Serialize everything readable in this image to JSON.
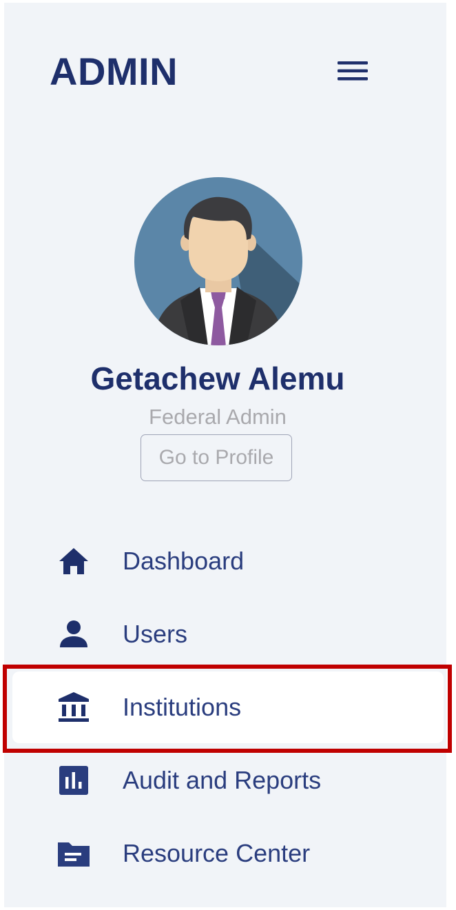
{
  "brand": {
    "title": "ADMIN"
  },
  "header": {
    "menu_icon": "hamburger-menu-icon"
  },
  "profile": {
    "name": "Getachew Alemu",
    "role": "Federal Admin",
    "button_label": "Go to Profile",
    "avatar_icon": "user-avatar"
  },
  "nav": {
    "items": [
      {
        "label": "Dashboard",
        "icon": "home-icon",
        "active": false
      },
      {
        "label": "Users",
        "icon": "user-icon",
        "active": false
      },
      {
        "label": "Institutions",
        "icon": "institution-icon",
        "active": true
      },
      {
        "label": "Audit and Reports",
        "icon": "bar-chart-icon",
        "active": false
      },
      {
        "label": "Resource Center",
        "icon": "folder-icon",
        "active": false
      }
    ]
  },
  "colors": {
    "sidebar_bg": "#f1f4f8",
    "primary": "#1e2f6b",
    "nav_text": "#2a3d7e",
    "muted": "#a9a9ad",
    "active_bg": "#ffffff",
    "highlight": "#c00000"
  }
}
